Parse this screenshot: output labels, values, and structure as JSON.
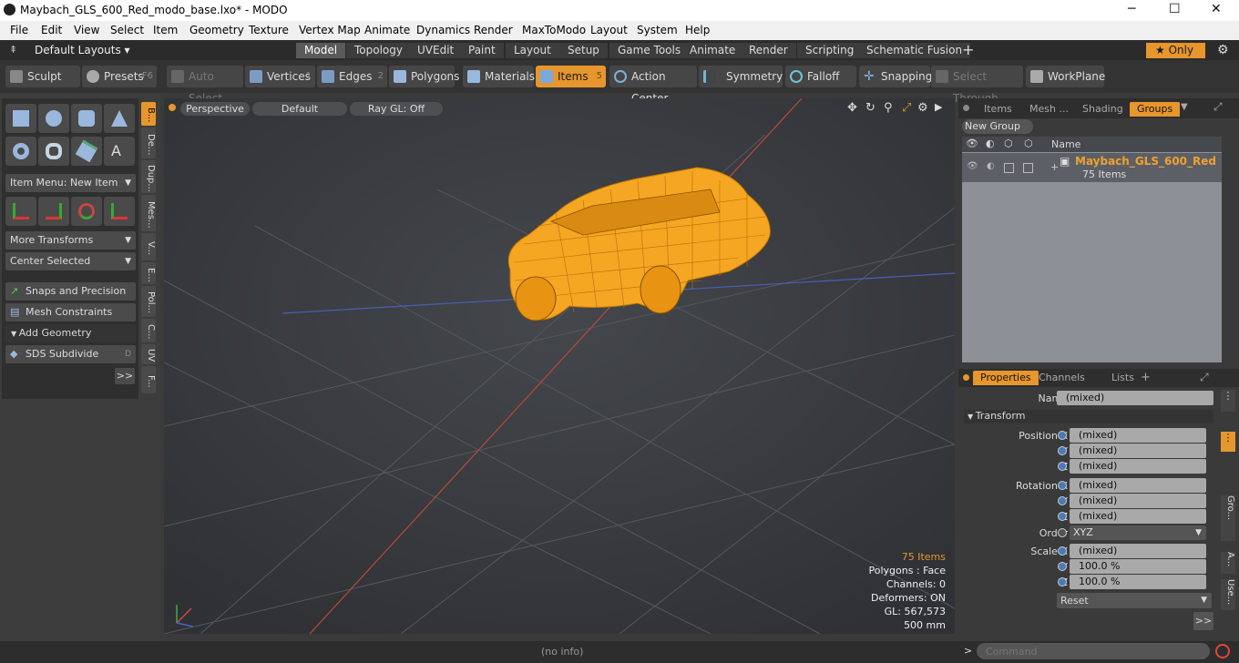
{
  "window": {
    "title": "Maybach_GLS_600_Red_modo_base.lxo* - MODO",
    "minimize": "─",
    "maximize": "☐",
    "close": "✕"
  },
  "menu": [
    "File",
    "Edit",
    "View",
    "Select",
    "Item",
    "Geometry",
    "Texture",
    "Vertex Map",
    "Animate",
    "Dynamics",
    "Render",
    "MaxToModo",
    "Layout",
    "System",
    "Help"
  ],
  "layout_tabs": {
    "default_layouts": "Default Layouts ▾",
    "tabs": [
      "Model",
      "Topology",
      "UVEdit",
      "Paint",
      "Layout",
      "Setup",
      "Game Tools",
      "Animate",
      "Render",
      "Scripting",
      "Schematic Fusion"
    ],
    "active": "Model",
    "add": "+",
    "only": "★  Only"
  },
  "toolbar": {
    "sculpt": "Sculpt",
    "presets": "Presets",
    "presets_key": "F6",
    "auto_select": "Auto Select",
    "vertices": "Vertices",
    "vertices_num": "1",
    "edges": "Edges",
    "edges_num": "2",
    "polygons": "Polygons",
    "materials": "Materials",
    "items": "Items",
    "items_num": "5",
    "action_center": "Action Center",
    "symmetry": "Symmetry",
    "falloff": "Falloff",
    "snapping": "Snapping",
    "select_through": "Select Through",
    "workplane": "WorkPlane"
  },
  "left_panel": {
    "item_menu": "Item Menu: New Item",
    "more_transforms": "More Transforms",
    "center_selected": "Center Selected",
    "snaps": "Snaps and Precision",
    "mesh_constraints": "Mesh Constraints",
    "add_geometry": "Add Geometry",
    "sds_subdivide": "SDS Subdivide",
    "sds_key": "D",
    "more": ">>",
    "vtabs": [
      "B...",
      "De...",
      "Dup...",
      "Mes...",
      "V...",
      "E...",
      "Pol...",
      "C...",
      "UV",
      "F..."
    ]
  },
  "viewport": {
    "perspective": "Perspective",
    "default": "Default",
    "raygl": "Ray GL: Off",
    "stats": {
      "items": "75 Items",
      "polygons": "Polygons : Face",
      "channels": "Channels: 0",
      "deformers": "Deformers: ON",
      "gl": "GL: 567,573",
      "scale": "500 mm"
    }
  },
  "groups_panel": {
    "tabs": [
      "Items",
      "Mesh ...",
      "Shading",
      "Groups"
    ],
    "active": "Groups",
    "new_group": "New Group",
    "col_name": "Name",
    "group_name": "Maybach_GLS_600_Red",
    "group_count": "75 Items"
  },
  "properties_panel": {
    "tabs": [
      "Properties",
      "Channels",
      "Lists"
    ],
    "active": "Properties",
    "add": "+",
    "name_label": "Name",
    "name_value": "(mixed)",
    "transform": "Transform",
    "rows": [
      {
        "label": "Position X",
        "value": "(mixed)"
      },
      {
        "label": "Y",
        "value": "(mixed)"
      },
      {
        "label": "Z",
        "value": "(mixed)"
      },
      {
        "label": "Rotation X",
        "value": "(mixed)"
      },
      {
        "label": "Y",
        "value": "(mixed)"
      },
      {
        "label": "Z",
        "value": "(mixed)"
      }
    ],
    "order_label": "Order",
    "order_value": "XYZ",
    "scale_rows": [
      {
        "label": "Scale X",
        "value": "(mixed)"
      },
      {
        "label": "Y",
        "value": "100.0 %"
      },
      {
        "label": "Z",
        "value": "100.0 %"
      }
    ],
    "reset": "Reset",
    "more": ">>",
    "side_tabs": [
      "Gro...",
      "A...",
      "Use..."
    ]
  },
  "status": {
    "info": "(no info)",
    "command_prompt": ">",
    "command_placeholder": "Command"
  },
  "colors": {
    "accent": "#e6962c",
    "wire": "#f5a623"
  }
}
